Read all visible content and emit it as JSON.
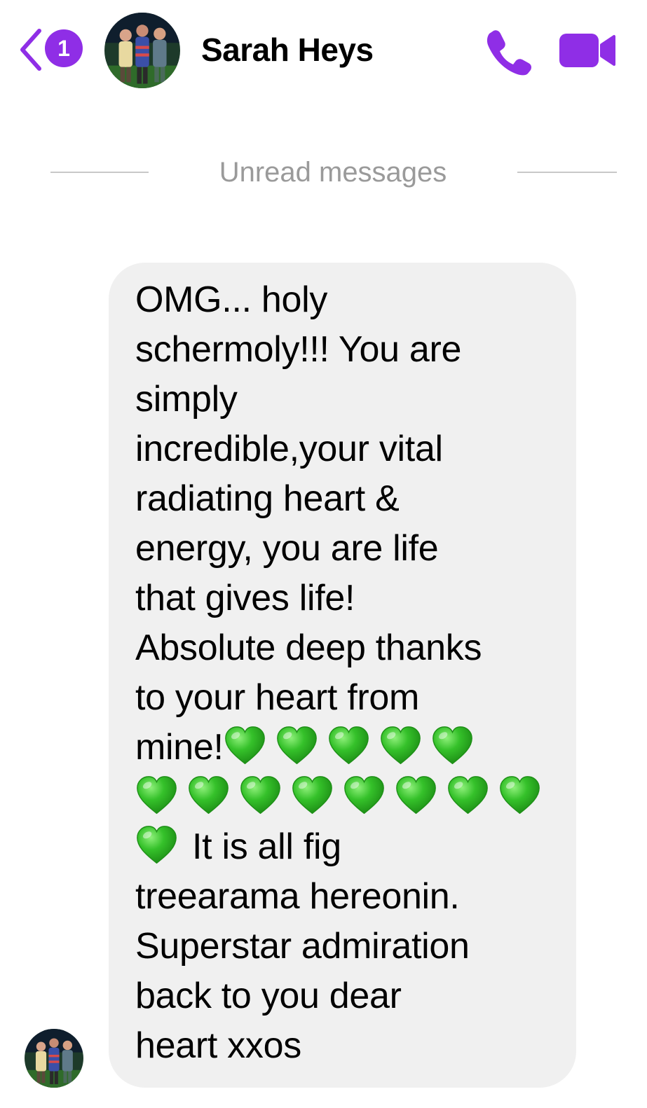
{
  "header": {
    "unread_count": "1",
    "contact_name": "Sarah Heys",
    "back_icon": "chevron-left-icon",
    "call_icon": "phone-icon",
    "video_icon": "video-camera-icon",
    "accent_color": "#8f2ee6"
  },
  "divider": {
    "label": "Unread messages"
  },
  "message": {
    "line1": "OMG... holy",
    "line2": "schermoly!!! You are",
    "line3": "simply",
    "line4": "incredible,your vital",
    "line5": "radiating heart &",
    "line6": "energy, you are life",
    "line7": "that gives life!",
    "line8": "Absolute deep thanks",
    "line9": "to your heart from",
    "line10": "mine!",
    "line13": "It is all fig",
    "line14": "treearama hereonin.",
    "line15": "Superstar admiration",
    "line16": "back to you dear",
    "line17": "heart xxos",
    "emoji": "green-heart",
    "emoji_count": 14,
    "bubble_color": "#f0f0f0"
  }
}
